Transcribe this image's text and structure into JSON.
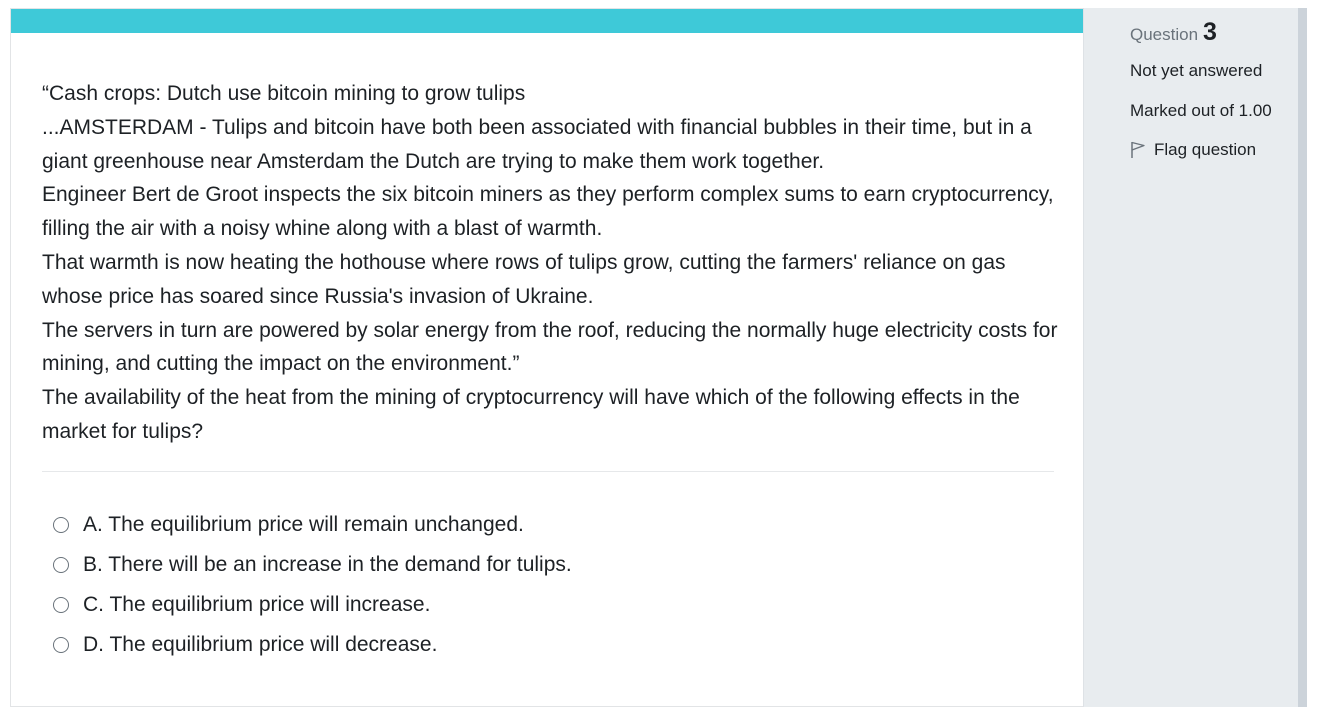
{
  "question": {
    "paragraphs": [
      "“Cash crops: Dutch use bitcoin mining to grow tulips",
      "...AMSTERDAM - Tulips and bitcoin have both been associated with financial bubbles in their time, but in a giant greenhouse near Amsterdam the Dutch are trying to make them work together.",
      "Engineer Bert de Groot inspects the six bitcoin miners as they perform complex sums to earn cryptocurrency, filling the air with a noisy whine along with a blast of warmth.",
      "That warmth is now heating the hothouse where rows of tulips grow, cutting the farmers' reliance on gas whose price has soared since Russia's invasion of Ukraine.",
      "The servers in turn are powered by solar energy from the roof, reducing the normally huge electricity costs for mining, and cutting the impact on the environment.”",
      "The availability of the heat from the mining of cryptocurrency will have which of the following effects in the market for tulips?"
    ],
    "answers": [
      {
        "label": "A. The equilibrium price will remain unchanged.",
        "selected": false
      },
      {
        "label": "B. There will be an increase in the demand for tulips.",
        "selected": false
      },
      {
        "label": "C. The equilibrium price will increase.",
        "selected": false
      },
      {
        "label": "D. The equilibrium price will decrease.",
        "selected": false
      }
    ]
  },
  "info": {
    "question_label": "Question",
    "question_number": "3",
    "state": "Not yet answered",
    "grade": "Marked out of 1.00",
    "flag_label": "Flag question",
    "flag_icon": "flag-outline-icon"
  },
  "colors": {
    "accent": "#3ec9d8",
    "panel_bg": "#e8ecef",
    "text": "#1d2125",
    "muted": "#6a737b"
  }
}
